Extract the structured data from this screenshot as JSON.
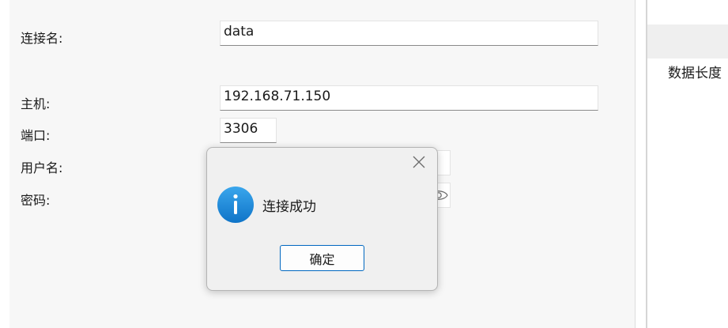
{
  "form": {
    "connection_name_label": "连接名:",
    "connection_name_value": "data",
    "host_label": "主机:",
    "host_value": "192.168.71.150",
    "port_label": "端口:",
    "port_value": "3306",
    "username_label": "用户名:",
    "password_label": "密码:"
  },
  "right_panel": {
    "column_header": "数据长度"
  },
  "dialog": {
    "message": "连接成功",
    "ok_label": "确定",
    "icon": "info-icon",
    "close_icon": "close-icon"
  },
  "colors": {
    "accent": "#0067c0",
    "info_icon": "#1a8fdc",
    "dialog_bg": "#f0f0f0",
    "panel_bg": "#f7f7f7"
  }
}
